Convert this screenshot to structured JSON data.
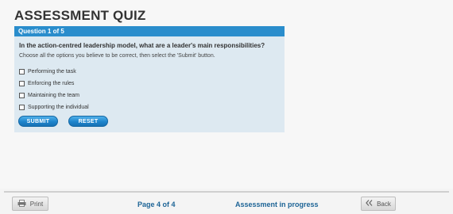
{
  "page_title": "ASSESSMENT QUIZ",
  "quiz": {
    "header": "Question 1 of 5",
    "question": "In the action-centred leadership model, what are a leader's main responsibilities?",
    "instructions": "Choose all the options you believe to be correct, then select the 'Submit' button.",
    "options": [
      "Performing the task",
      "Enforcing the rules",
      "Maintaining the team",
      "Supporting the individual"
    ],
    "submit_label": "SUBMIT",
    "reset_label": "RESET"
  },
  "footer": {
    "print_label": "Print",
    "print_icon": "printer-icon",
    "page_indicator": "Page 4 of 4",
    "status": "Assessment in progress",
    "back_label": "Back",
    "back_icon": "double-chevron-left-icon"
  },
  "colors": {
    "accent": "#2a8dcc",
    "panel": "#dde9f1",
    "footer_text": "#1d6496"
  }
}
